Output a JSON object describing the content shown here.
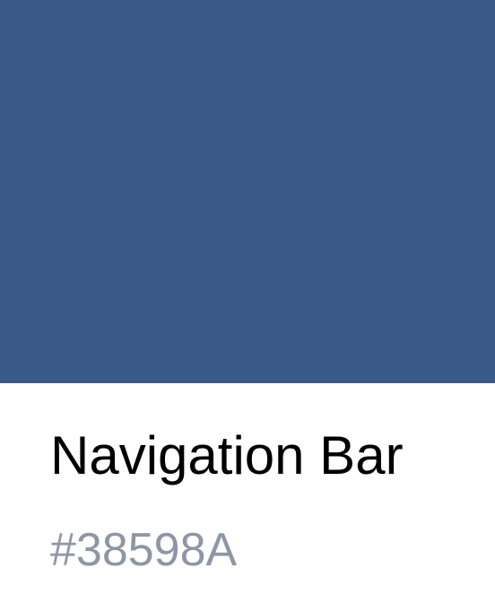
{
  "swatch": {
    "name": "Navigation Bar",
    "hex": "#38598A",
    "color": "#38598A"
  },
  "colors": {
    "name_text": "#000000",
    "hex_text": "#8E96A6",
    "background": "#FFFFFF"
  }
}
